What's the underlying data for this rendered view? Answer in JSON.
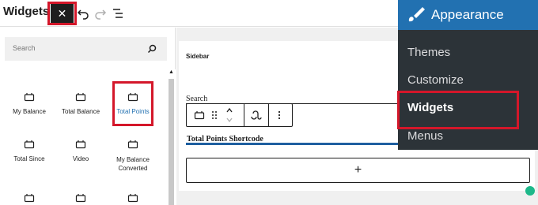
{
  "toolbar": {
    "title": "Widgets",
    "close_glyph": "✕",
    "icons": [
      "close-icon",
      "undo-icon",
      "redo-icon",
      "list-view-icon"
    ]
  },
  "inserter": {
    "search_placeholder": "Search",
    "blocks": [
      {
        "label": "My Balance"
      },
      {
        "label": "Total Balance"
      },
      {
        "label": "Total Points",
        "selected": true
      },
      {
        "label": "Total Since"
      },
      {
        "label": "Video"
      },
      {
        "label": "My Balance Converted"
      }
    ]
  },
  "editor": {
    "sidebar_title": "Sidebar",
    "search_heading": "Search",
    "shortcode_heading": "Total Points Shortcode",
    "add_glyph": "+"
  },
  "admin_menu": {
    "heading": "Appearance",
    "items": [
      "Themes",
      "Customize",
      "Widgets",
      "Menus"
    ],
    "active": "Widgets"
  },
  "colors": {
    "admin_bg": "#2c3338",
    "admin_accent": "#2271b1",
    "highlight": "#d4172a",
    "selected_text": "#2271b1"
  }
}
